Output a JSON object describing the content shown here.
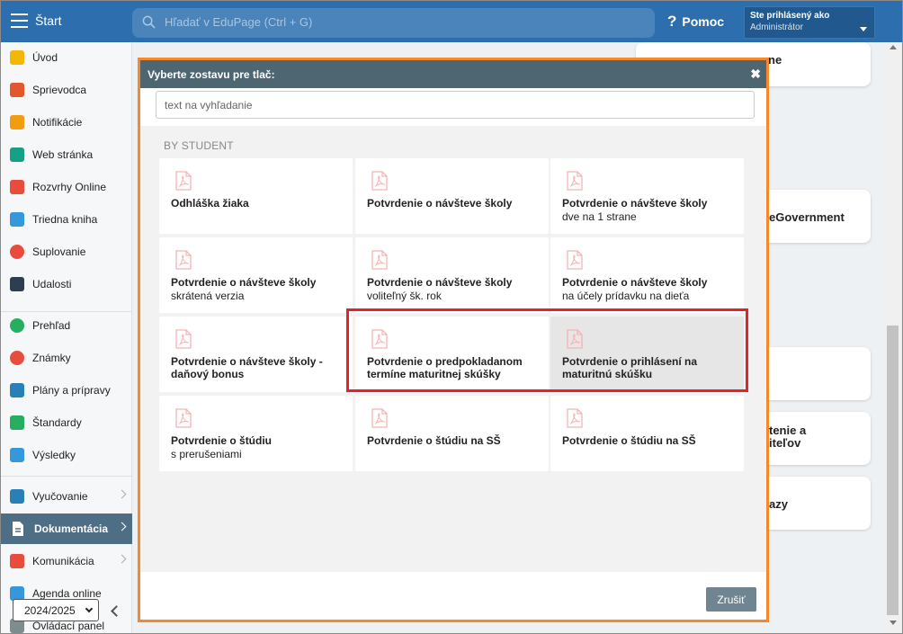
{
  "topbar": {
    "app_title": "Štart",
    "search_placeholder": "Hľadať v EduPage (Ctrl + G)",
    "help_label": "Pomoc",
    "user_line1": "Ste prihlásený ako",
    "user_line2": "Administrátor"
  },
  "sidebar": {
    "items": [
      {
        "label": "Úvod",
        "icon": "star-icon",
        "color": "#f2b705"
      },
      {
        "label": "Sprievodca",
        "icon": "wand-icon",
        "color": "#e4572e"
      },
      {
        "label": "Notifikácie",
        "icon": "envelope-icon",
        "color": "#f39c12"
      },
      {
        "label": "Web stránka",
        "icon": "home-icon",
        "color": "#16a085"
      },
      {
        "label": "Rozvrhy Online",
        "icon": "calendar-grid-icon",
        "color": "#e74c3c"
      },
      {
        "label": "Triedna kniha",
        "icon": "book-icon",
        "color": "#3498db"
      },
      {
        "label": "Suplovanie",
        "icon": "person-icon",
        "color": "#e74c3c"
      },
      {
        "label": "Udalosti",
        "icon": "calendar-icon",
        "color": "#2c3e50"
      },
      {
        "label": "Prehľad",
        "icon": "check-circle-icon",
        "color": "#27ae60"
      },
      {
        "label": "Známky",
        "icon": "chart-circle-icon",
        "color": "#e74c3c"
      },
      {
        "label": "Plány a prípravy",
        "icon": "briefcase-icon",
        "color": "#2980b9"
      },
      {
        "label": "Štandardy",
        "icon": "shield-check-icon",
        "color": "#27ae60"
      },
      {
        "label": "Výsledky",
        "icon": "bar-chart-icon",
        "color": "#3498db"
      },
      {
        "label": "Vyučovanie",
        "icon": "open-book-icon",
        "color": "#2980b9"
      },
      {
        "label": "Dokumentácia",
        "icon": "document-icon",
        "color": "#ffffff"
      },
      {
        "label": "Komunikácia",
        "icon": "chat-icon",
        "color": "#e74c3c"
      },
      {
        "label": "Agenda online",
        "icon": "stripes-icon",
        "color": "#3498db"
      },
      {
        "label": "Ovládací panel",
        "icon": "gear-icon",
        "color": "#7f8c8d"
      }
    ],
    "year": "2024/2025"
  },
  "background": {
    "cards": [
      "ne",
      "eGovernment",
      "tenie a\niteľov",
      "azy"
    ]
  },
  "modal": {
    "title": "Vyberte zostavu pre tlač:",
    "close": "✖",
    "search_placeholder": "text na vyhľadanie",
    "section": "BY STUDENT",
    "cancel_label": "Zrušiť",
    "tiles": [
      {
        "title": "Odhláška žiaka",
        "subtitle": ""
      },
      {
        "title": "Potvrdenie o návšteve školy",
        "subtitle": ""
      },
      {
        "title": "Potvrdenie o návšteve školy",
        "subtitle": "dve na 1 strane"
      },
      {
        "title": "Potvrdenie o návšteve školy",
        "subtitle": "skrátená verzia"
      },
      {
        "title": "Potvrdenie o návšteve školy",
        "subtitle": "voliteľný šk. rok"
      },
      {
        "title": "Potvrdenie o návšteve školy",
        "subtitle": "na účely prídavku na dieťa"
      },
      {
        "title": "Potvrdenie o návšteve školy - daňový bonus",
        "subtitle": ""
      },
      {
        "title": "Potvrdenie o predpokladanom termíne maturitnej skúšky",
        "subtitle": ""
      },
      {
        "title": "Potvrdenie o prihlásení na maturitnú skúšku",
        "subtitle": ""
      },
      {
        "title": "Potvrdenie o štúdiu",
        "subtitle": "s prerušeniami"
      },
      {
        "title": "Potvrdenie o štúdiu na SŠ",
        "subtitle": ""
      },
      {
        "title": "Potvrdenie o štúdiu na SŠ",
        "subtitle": ""
      }
    ]
  }
}
